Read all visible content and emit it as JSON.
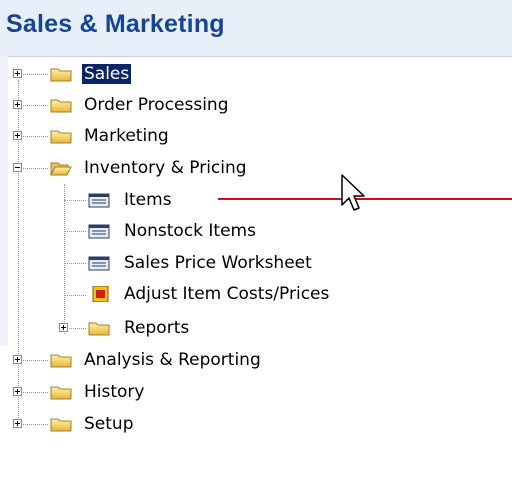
{
  "header": {
    "title": "Sales & Marketing"
  },
  "tree": {
    "sales": "Sales",
    "order_processing": "Order Processing",
    "marketing": "Marketing",
    "inventory_pricing": "Inventory & Pricing",
    "items": "Items",
    "nonstock_items": "Nonstock Items",
    "sales_price_worksheet": "Sales Price Worksheet",
    "adjust_item_costs": "Adjust Item Costs/Prices",
    "reports": "Reports",
    "analysis_reporting": "Analysis & Reporting",
    "history": "History",
    "setup": "Setup"
  },
  "colors": {
    "title": "#12459a",
    "selection": "#0a246a",
    "annotation_line": "#d01010"
  }
}
